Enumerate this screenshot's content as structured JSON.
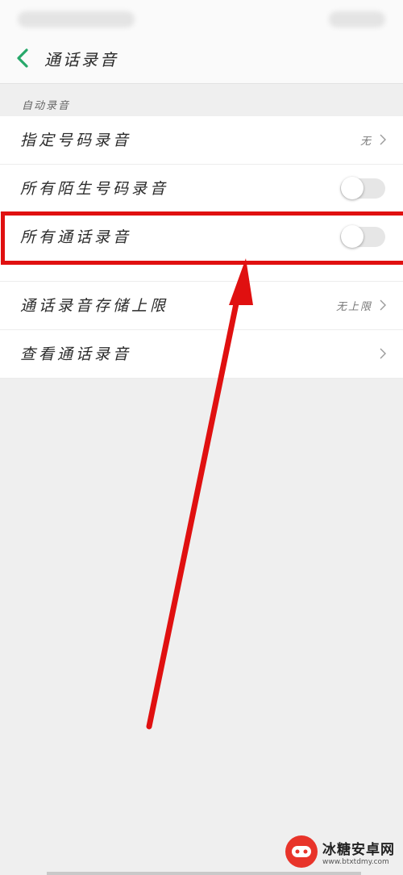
{
  "header": {
    "title": "通话录音"
  },
  "section": {
    "auto_record": "自动录音"
  },
  "rows": [
    {
      "label": "指定号码录音",
      "value": "无"
    },
    {
      "label": "所有陌生号码录音",
      "toggle": false
    },
    {
      "label": "所有通话录音",
      "toggle": false
    },
    {
      "label": "通话录音存储上限",
      "value": "无上限"
    },
    {
      "label": "查看通话录音"
    }
  ],
  "icons": {
    "back": "chevron-left-icon",
    "chevron": "chevron-right-icon"
  },
  "colors": {
    "accent": "#27a86a",
    "highlight": "#e01010",
    "arrow": "#e01010"
  },
  "annotation": {
    "highlighted_row": "所有通话录音"
  },
  "watermark": {
    "title": "冰糖安卓网",
    "url": "www.btxtdmy.com"
  }
}
